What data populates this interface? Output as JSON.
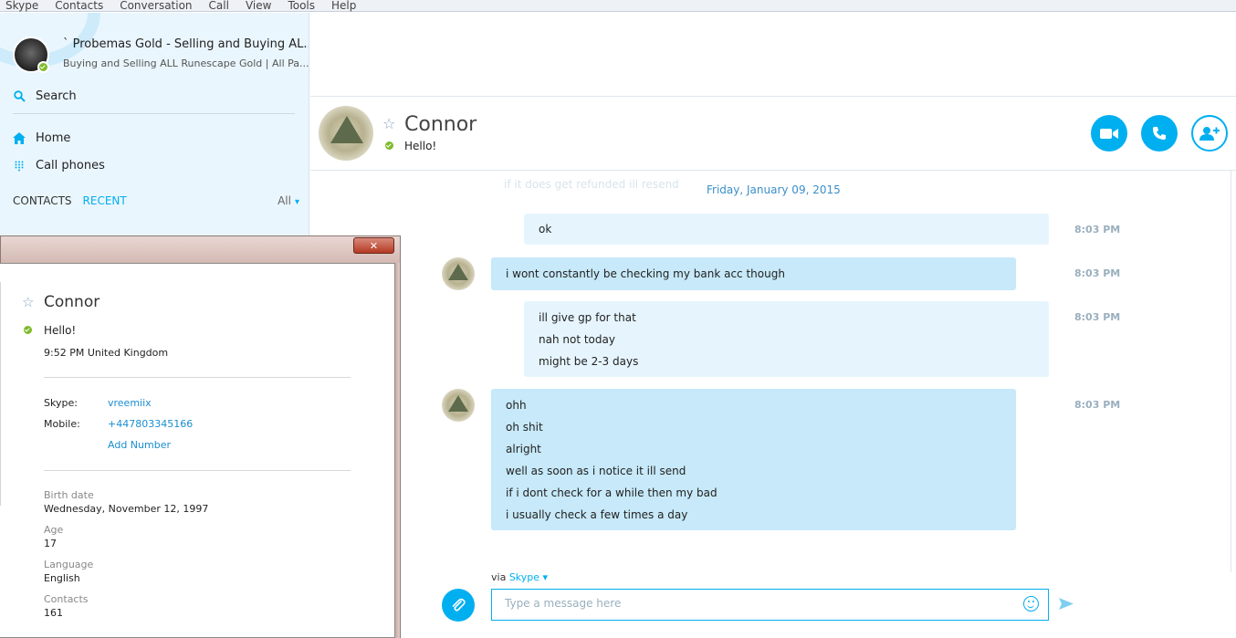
{
  "menu": [
    "Skype",
    "Contacts",
    "Conversation",
    "Call",
    "View",
    "Tools",
    "Help"
  ],
  "profile": {
    "name": "` Probemas Gold - Selling and Buying AL...",
    "mood": "Buying and Selling ALL Runescape Gold | All Pa..."
  },
  "sidebar": {
    "search_label": "Search",
    "home_label": "Home",
    "call_phones_label": "Call phones",
    "tab_contacts": "CONTACTS",
    "tab_recent": "RECENT",
    "filter_all": "All"
  },
  "conversation": {
    "contact_name": "Connor",
    "mood": "Hello!",
    "faded_previous_message": "if it does get refunded ill resend",
    "date_separator": "Friday, January 09, 2015",
    "messages": [
      {
        "direction": "out",
        "lines": [
          "ok"
        ],
        "time": "8:03 PM"
      },
      {
        "direction": "in",
        "lines": [
          "i wont constantly be checking my bank acc though"
        ],
        "time": "8:03 PM"
      },
      {
        "direction": "out",
        "lines": [
          "ill give gp for that",
          "nah not today",
          "might be 2-3 days"
        ],
        "time": "8:03 PM"
      },
      {
        "direction": "in",
        "lines": [
          "ohh",
          "oh shit",
          "alright",
          "well as soon as i notice it ill send",
          "if i dont check for a while then my bad",
          "i usually check a few times a day"
        ],
        "time": "8:03 PM"
      }
    ],
    "via_label": "via",
    "via_link": "Skype",
    "compose_placeholder": "Type a message here"
  },
  "contact_card": {
    "name": "Connor",
    "mood": "Hello!",
    "local_time": "9:52 PM United Kingdom",
    "skype_label": "Skype:",
    "skype_value": "vreemiix",
    "mobile_label": "Mobile:",
    "mobile_value": "+447803345166",
    "add_number": "Add Number",
    "birth_date_label": "Birth date",
    "birth_date_value": "Wednesday, November 12, 1997",
    "age_label": "Age",
    "age_value": "17",
    "language_label": "Language",
    "language_value": "English",
    "contacts_label": "Contacts",
    "contacts_value": "161"
  },
  "colors": {
    "accent": "#00aff0",
    "incoming_bubble": "#c7e9f9",
    "outgoing_bubble": "#e6f5fd",
    "presence_online": "#7fbb2a"
  }
}
